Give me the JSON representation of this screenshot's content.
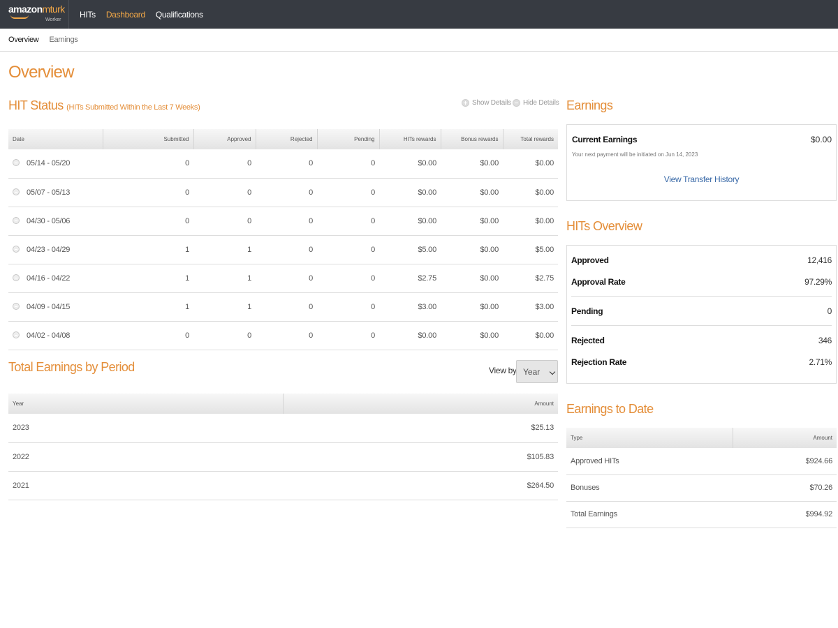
{
  "logo": {
    "brand": "amazon",
    "product": "mturk",
    "sub": "Worker"
  },
  "topnav": [
    {
      "label": "HITs",
      "active": false
    },
    {
      "label": "Dashboard",
      "active": true
    },
    {
      "label": "Qualifications",
      "active": false
    }
  ],
  "subnav": [
    {
      "label": "Overview",
      "active": true
    },
    {
      "label": "Earnings",
      "active": false
    }
  ],
  "page_title": "Overview",
  "hit_status": {
    "title": "HIT Status",
    "subtitle": "(HITs Submitted Within the Last 7 Weeks)",
    "show_details": "Show Details",
    "hide_details": "Hide Details",
    "columns": [
      "Date",
      "Submitted",
      "Approved",
      "Rejected",
      "Pending",
      "HITs rewards",
      "Bonus rewards",
      "Total rewards"
    ],
    "rows": [
      [
        "05/14 - 05/20",
        "0",
        "0",
        "0",
        "0",
        "$0.00",
        "$0.00",
        "$0.00"
      ],
      [
        "05/07 - 05/13",
        "0",
        "0",
        "0",
        "0",
        "$0.00",
        "$0.00",
        "$0.00"
      ],
      [
        "04/30 - 05/06",
        "0",
        "0",
        "0",
        "0",
        "$0.00",
        "$0.00",
        "$0.00"
      ],
      [
        "04/23 - 04/29",
        "1",
        "1",
        "0",
        "0",
        "$5.00",
        "$0.00",
        "$5.00"
      ],
      [
        "04/16 - 04/22",
        "1",
        "1",
        "0",
        "0",
        "$2.75",
        "$0.00",
        "$2.75"
      ],
      [
        "04/09 - 04/15",
        "1",
        "1",
        "0",
        "0",
        "$3.00",
        "$0.00",
        "$3.00"
      ],
      [
        "04/02 - 04/08",
        "0",
        "0",
        "0",
        "0",
        "$0.00",
        "$0.00",
        "$0.00"
      ]
    ]
  },
  "earnings_by_period": {
    "title": "Total Earnings by Period",
    "view_by_label": "View by:",
    "view_by_value": "Year",
    "columns": [
      "Year",
      "Amount"
    ],
    "rows": [
      [
        "2023",
        "$25.13"
      ],
      [
        "2022",
        "$105.83"
      ],
      [
        "2021",
        "$264.50"
      ]
    ]
  },
  "earnings": {
    "title": "Earnings",
    "current_label": "Current Earnings",
    "current_value": "$0.00",
    "note": "Your next payment will be initiated on Jun 14, 2023",
    "link": "View Transfer History"
  },
  "hits_overview": {
    "title": "HITs Overview",
    "items": [
      {
        "label": "Approved",
        "value": "12,416"
      },
      {
        "label": "Approval Rate",
        "value": "97.29%"
      },
      {
        "label": "Pending",
        "value": "0"
      },
      {
        "label": "Rejected",
        "value": "346"
      },
      {
        "label": "Rejection Rate",
        "value": "2.71%"
      }
    ]
  },
  "earnings_to_date": {
    "title": "Earnings to Date",
    "columns": [
      "Type",
      "Amount"
    ],
    "rows": [
      [
        "Approved HITs",
        "$924.66"
      ],
      [
        "Bonuses",
        "$70.26"
      ],
      [
        "Total Earnings",
        "$994.92"
      ]
    ]
  }
}
